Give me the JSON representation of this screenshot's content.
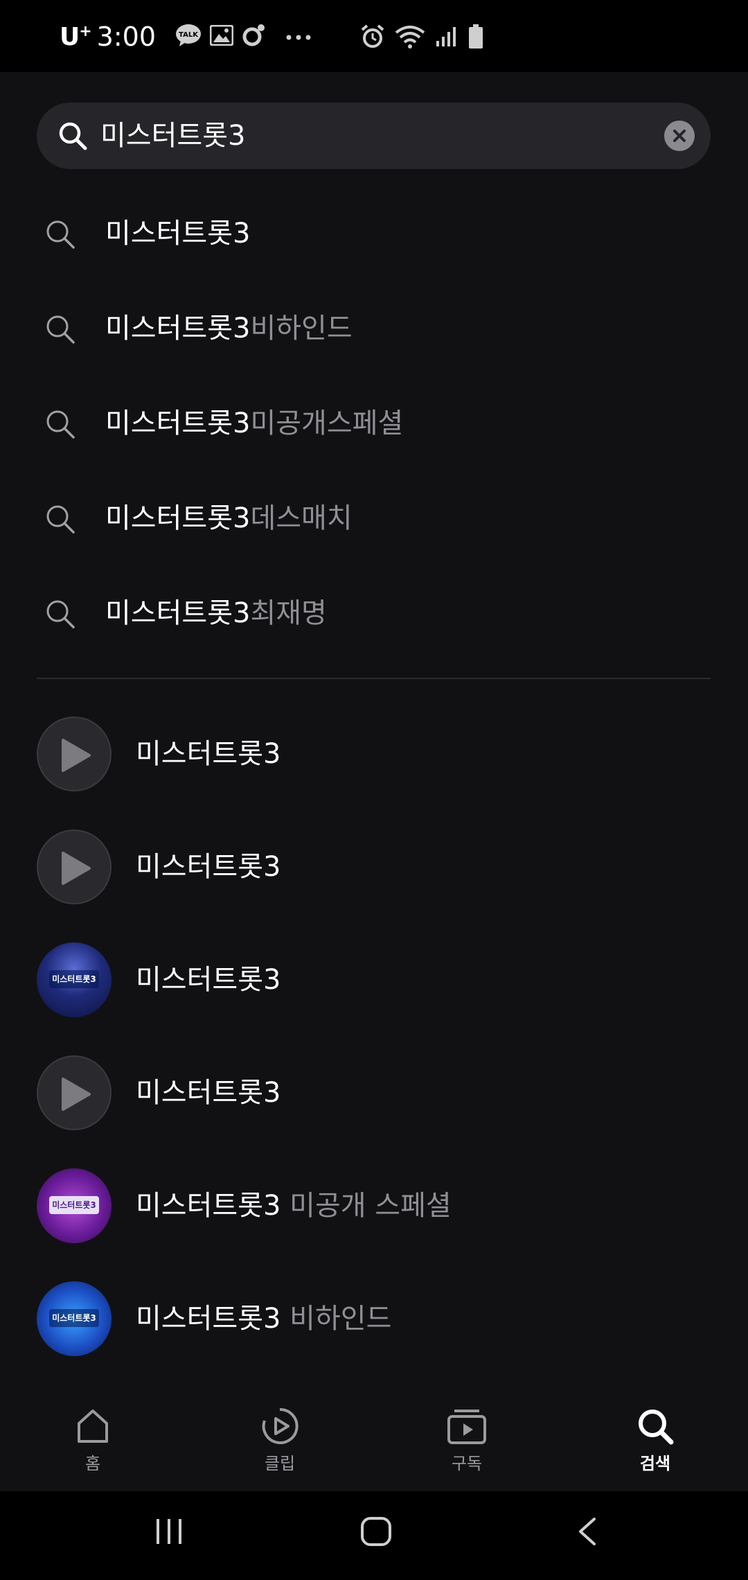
{
  "status_bar": {
    "carrier": "U",
    "carrier_sup": "+",
    "time": "3:00",
    "kakao_badge": "TALK",
    "icons": [
      "kakaotalk-icon",
      "gallery-icon",
      "camera-dot-icon",
      "more-dots-icon",
      "alarm-icon",
      "wifi-icon",
      "signal-icon",
      "battery-icon"
    ]
  },
  "search": {
    "query": "미스터트롯3",
    "icon": "search-icon",
    "clear_icon": "clear-icon"
  },
  "suggestions": [
    {
      "match": "미스터트롯3",
      "rest": ""
    },
    {
      "match": "미스터트롯3",
      "rest": "비하인드"
    },
    {
      "match": "미스터트롯3",
      "rest": "미공개스페셜"
    },
    {
      "match": "미스터트롯3",
      "rest": "데스매치"
    },
    {
      "match": "미스터트롯3",
      "rest": "최재명"
    }
  ],
  "results": [
    {
      "title": "미스터트롯3",
      "sub": "",
      "thumb": "play-icon"
    },
    {
      "title": "미스터트롯3",
      "sub": "",
      "thumb": "play-icon"
    },
    {
      "title": "미스터트롯3",
      "sub": "",
      "thumb": "program-poster",
      "thumb_text": "미스터트롯3"
    },
    {
      "title": "미스터트롯3",
      "sub": "",
      "thumb": "play-icon"
    },
    {
      "title": "미스터트롯3",
      "sub": " 미공개 스페셜",
      "thumb": "program-poster",
      "thumb_text": "미스터트롯3"
    },
    {
      "title": "미스터트롯3",
      "sub": " 비하인드",
      "thumb": "program-poster",
      "thumb_text": "미스터트롯3"
    }
  ],
  "bottom_nav": [
    {
      "label": "홈",
      "icon": "home-icon",
      "active": false
    },
    {
      "label": "클립",
      "icon": "clip-play-icon",
      "active": false
    },
    {
      "label": "구독",
      "icon": "subscribe-icon",
      "active": false
    },
    {
      "label": "검색",
      "icon": "search-icon",
      "active": true
    }
  ],
  "colors": {
    "background": "#111114",
    "search_bg": "#25252a",
    "muted_text": "#8f8f95",
    "status_bar": "#000000"
  }
}
